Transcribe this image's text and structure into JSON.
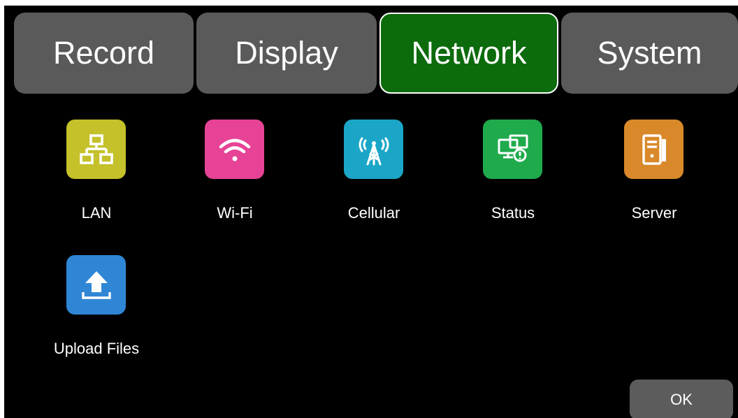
{
  "tabs": [
    {
      "label": "Record",
      "active": false
    },
    {
      "label": "Display",
      "active": false
    },
    {
      "label": "Network",
      "active": true
    },
    {
      "label": "System",
      "active": false
    }
  ],
  "items": [
    {
      "label": "LAN",
      "icon": "lan-icon",
      "color": "#c4c12a"
    },
    {
      "label": "Wi-Fi",
      "icon": "wifi-icon",
      "color": "#e74396"
    },
    {
      "label": "Cellular",
      "icon": "cellular-tower-icon",
      "color": "#1ba6c7"
    },
    {
      "label": "Status",
      "icon": "network-status-icon",
      "color": "#1faa4c"
    },
    {
      "label": "Server",
      "icon": "server-icon",
      "color": "#d9892a"
    },
    {
      "label": "Upload Files",
      "icon": "upload-icon",
      "color": "#2f86d5"
    }
  ],
  "ok_label": "OK",
  "colors": {
    "background": "#000000",
    "tab_inactive": "#5a5a5a",
    "tab_active": "#0c6b0c",
    "button": "#5c5c5c",
    "text": "#ffffff"
  }
}
